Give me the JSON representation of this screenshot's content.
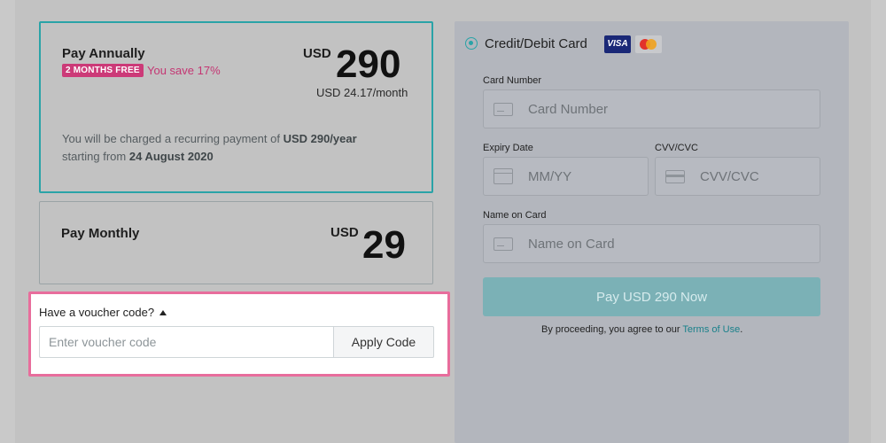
{
  "plans": {
    "annual": {
      "name": "Pay Annually",
      "badge": "2 MONTHS FREE",
      "savings": "You save 17%",
      "currency": "USD",
      "amount": "290",
      "per_month": "USD 24.17/month",
      "charge_text_1": "You will be charged a recurring payment of ",
      "charge_amount": "USD 290/year",
      "charge_text_2": "starting from ",
      "charge_date": "24 August 2020"
    },
    "monthly": {
      "name": "Pay Monthly",
      "currency": "USD",
      "amount": "29"
    }
  },
  "voucher": {
    "toggle_label": "Have a voucher code?",
    "placeholder": "Enter voucher code",
    "apply_label": "Apply Code"
  },
  "payment": {
    "method_label": "Credit/Debit Card",
    "visa_label": "VISA",
    "card_number_label": "Card Number",
    "card_number_placeholder": "Card Number",
    "expiry_label": "Expiry Date",
    "expiry_placeholder": "MM/YY",
    "cvv_label": "CVV/CVC",
    "cvv_placeholder": "CVV/CVC",
    "name_label": "Name on Card",
    "name_placeholder": "Name on Card",
    "pay_button": "Pay USD 290 Now",
    "terms_prefix": "By proceeding, you agree to our ",
    "terms_link": "Terms of Use",
    "terms_suffix": "."
  },
  "colors": {
    "accent": "#2aa3a7",
    "highlight": "#e86d9c",
    "badge": "#cc3a78"
  }
}
